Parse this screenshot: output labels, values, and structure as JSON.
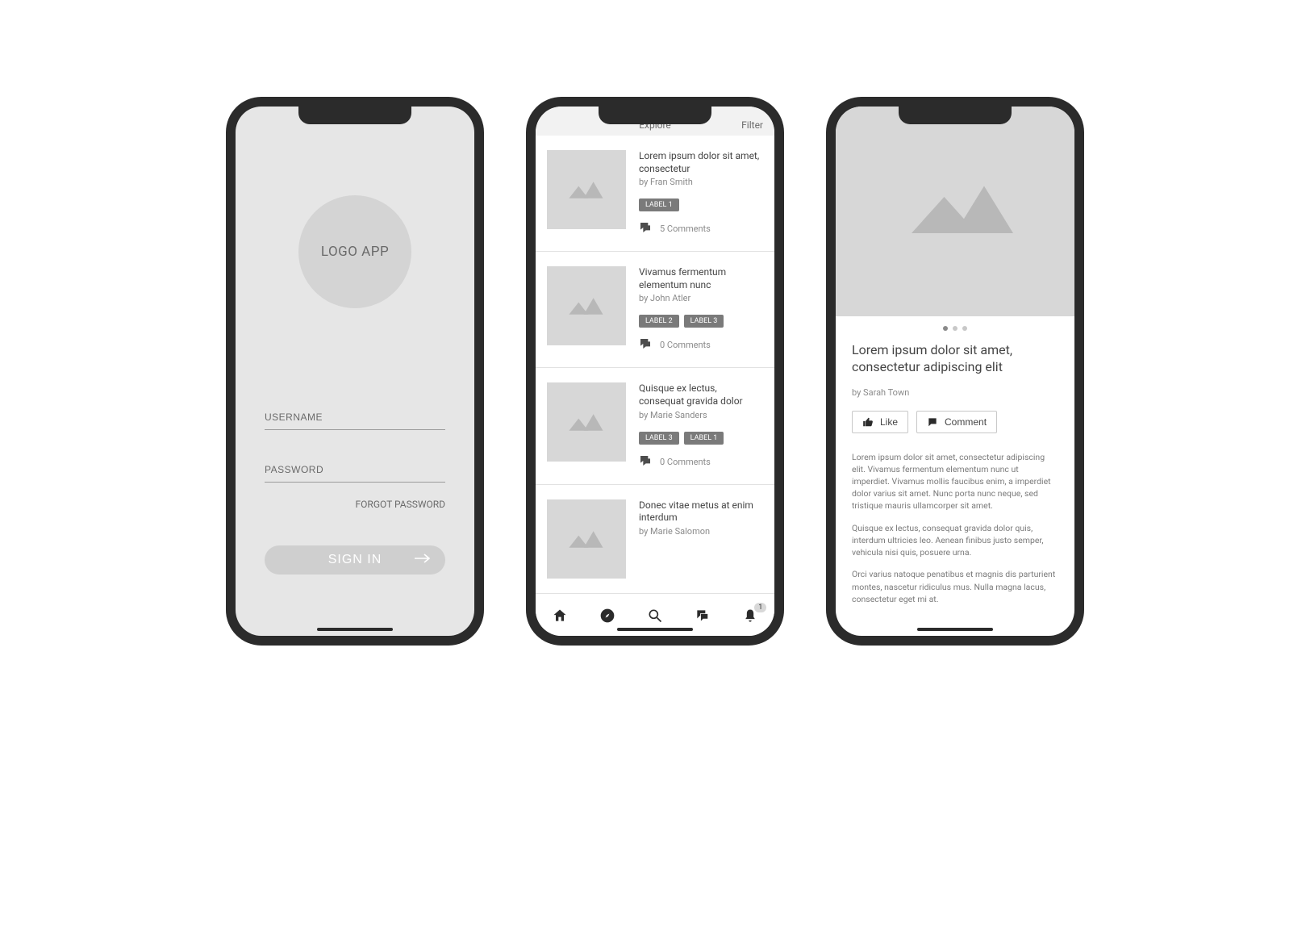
{
  "login": {
    "logo_text": "LOGO APP",
    "username_placeholder": "USERNAME",
    "password_placeholder": "PASSWORD",
    "forgot_label": "FORGOT PASSWORD",
    "signin_label": "SIGN IN"
  },
  "explore": {
    "topbar": {
      "title": "Explore",
      "filter": "Filter"
    },
    "cards": [
      {
        "title": "Lorem ipsum dolor sit amet, consectetur",
        "author": "by Fran Smith",
        "labels": [
          "LABEL 1"
        ],
        "comments": "5 Comments"
      },
      {
        "title": "Vivamus fermentum elementum nunc",
        "author": "by John Atler",
        "labels": [
          "LABEL 2",
          "LABEL 3"
        ],
        "comments": "0 Comments"
      },
      {
        "title": "Quisque ex lectus, consequat gravida dolor",
        "author": "by Marie Sanders",
        "labels": [
          "LABEL 3",
          "LABEL 1"
        ],
        "comments": "0 Comments"
      },
      {
        "title": "Donec vitae metus at enim interdum",
        "author": "by Marie Salomon",
        "labels": [],
        "comments": ""
      }
    ],
    "nav_badge": "1"
  },
  "detail": {
    "title": "Lorem ipsum dolor sit amet, consectetur adipiscing elit",
    "author": "by Sarah Town",
    "like_label": "Like",
    "comment_label": "Comment",
    "paragraphs": [
      "Lorem ipsum dolor sit amet, consectetur adipiscing elit. Vivamus fermentum elementum nunc ut imperdiet. Vivamus mollis faucibus enim, a imperdiet dolor varius sit amet. Nunc porta nunc neque, sed tristique mauris ullamcorper sit amet.",
      "Quisque ex lectus, consequat gravida dolor quis, interdum ultricies leo. Aenean finibus justo semper, vehicula nisi quis, posuere urna.",
      "Orci varius natoque penatibus et magnis dis parturient montes, nascetur ridiculus mus. Nulla magna lacus, consectetur eget mi at."
    ]
  }
}
